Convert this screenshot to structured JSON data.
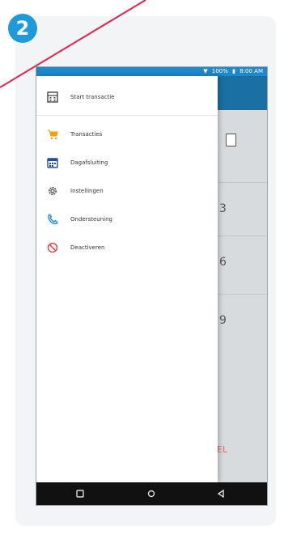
{
  "step_badge": "2",
  "status_bar": {
    "battery": "100%",
    "time": "8:00 AM"
  },
  "drawer": {
    "items": [
      {
        "label": "Start transactie",
        "icon": "calculator-icon"
      },
      {
        "label": "Transacties",
        "icon": "cart-icon"
      },
      {
        "label": "Dagafsluiting",
        "icon": "calendar-icon"
      },
      {
        "label": "Instellingen",
        "icon": "gear-icon"
      },
      {
        "label": "Ondersteuning",
        "icon": "phone-icon"
      },
      {
        "label": "Deactiveren",
        "icon": "forbidden-icon"
      }
    ]
  },
  "background": {
    "numbers": [
      "3",
      "6",
      "9"
    ],
    "cancel_fragment": "EL"
  },
  "colors": {
    "status_bar": "#1e88c9",
    "app_bar": "#1a6fa3",
    "badge": "#1f9ad9",
    "cart": "#f2a200",
    "calendar": "#1d4ea0",
    "phone": "#1f8fd8",
    "forbidden": "#e04848",
    "line": "#e5224a"
  }
}
